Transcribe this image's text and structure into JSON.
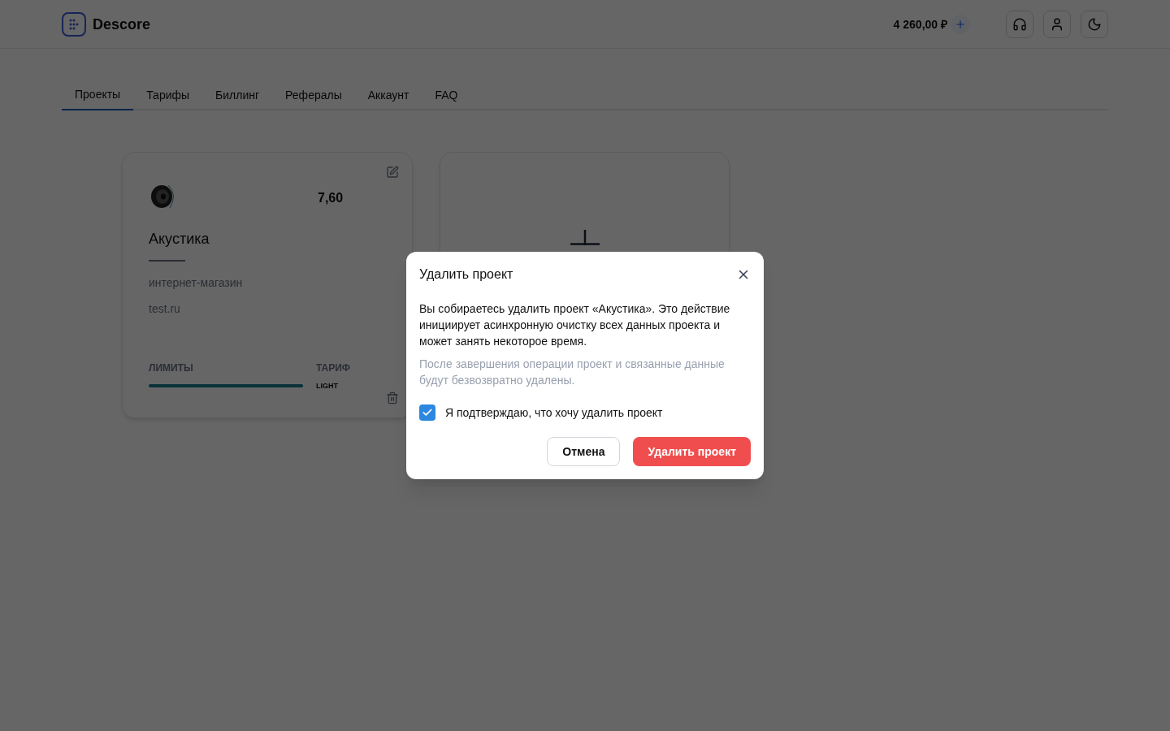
{
  "header": {
    "logo_text": "Descore",
    "balance": "4 260,00 ₽"
  },
  "tabs": [
    {
      "label": "Проекты",
      "selected": true
    },
    {
      "label": "Тарифы",
      "selected": false
    },
    {
      "label": "Биллинг",
      "selected": false
    },
    {
      "label": "Рефералы",
      "selected": false
    },
    {
      "label": "Аккаунт",
      "selected": false
    },
    {
      "label": "FAQ",
      "selected": false
    }
  ],
  "project_card": {
    "value": "7,60",
    "name": "Акустика",
    "category": "интернет-магазин",
    "domain": "test.ru",
    "limits_label": "ЛИМИТЫ",
    "limits": {
      "level": 1
    },
    "tariff_label": "ТАРИФ",
    "tariff": "LIGHT"
  },
  "dialog": {
    "title": "Удалить проект",
    "message": "Вы собираетесь удалить проект «Акустика». Это действие инициирует асинхронную очистку всех данных проекта и может занять некоторое время.",
    "note": "После завершения операции проект и связанные данные будут безвозвратно удалены.",
    "confirm": {
      "label": "Я подтверждаю, что хочу удалить проект",
      "checked": true
    },
    "cancel": "Отмена",
    "delete": "Удалить проект"
  }
}
